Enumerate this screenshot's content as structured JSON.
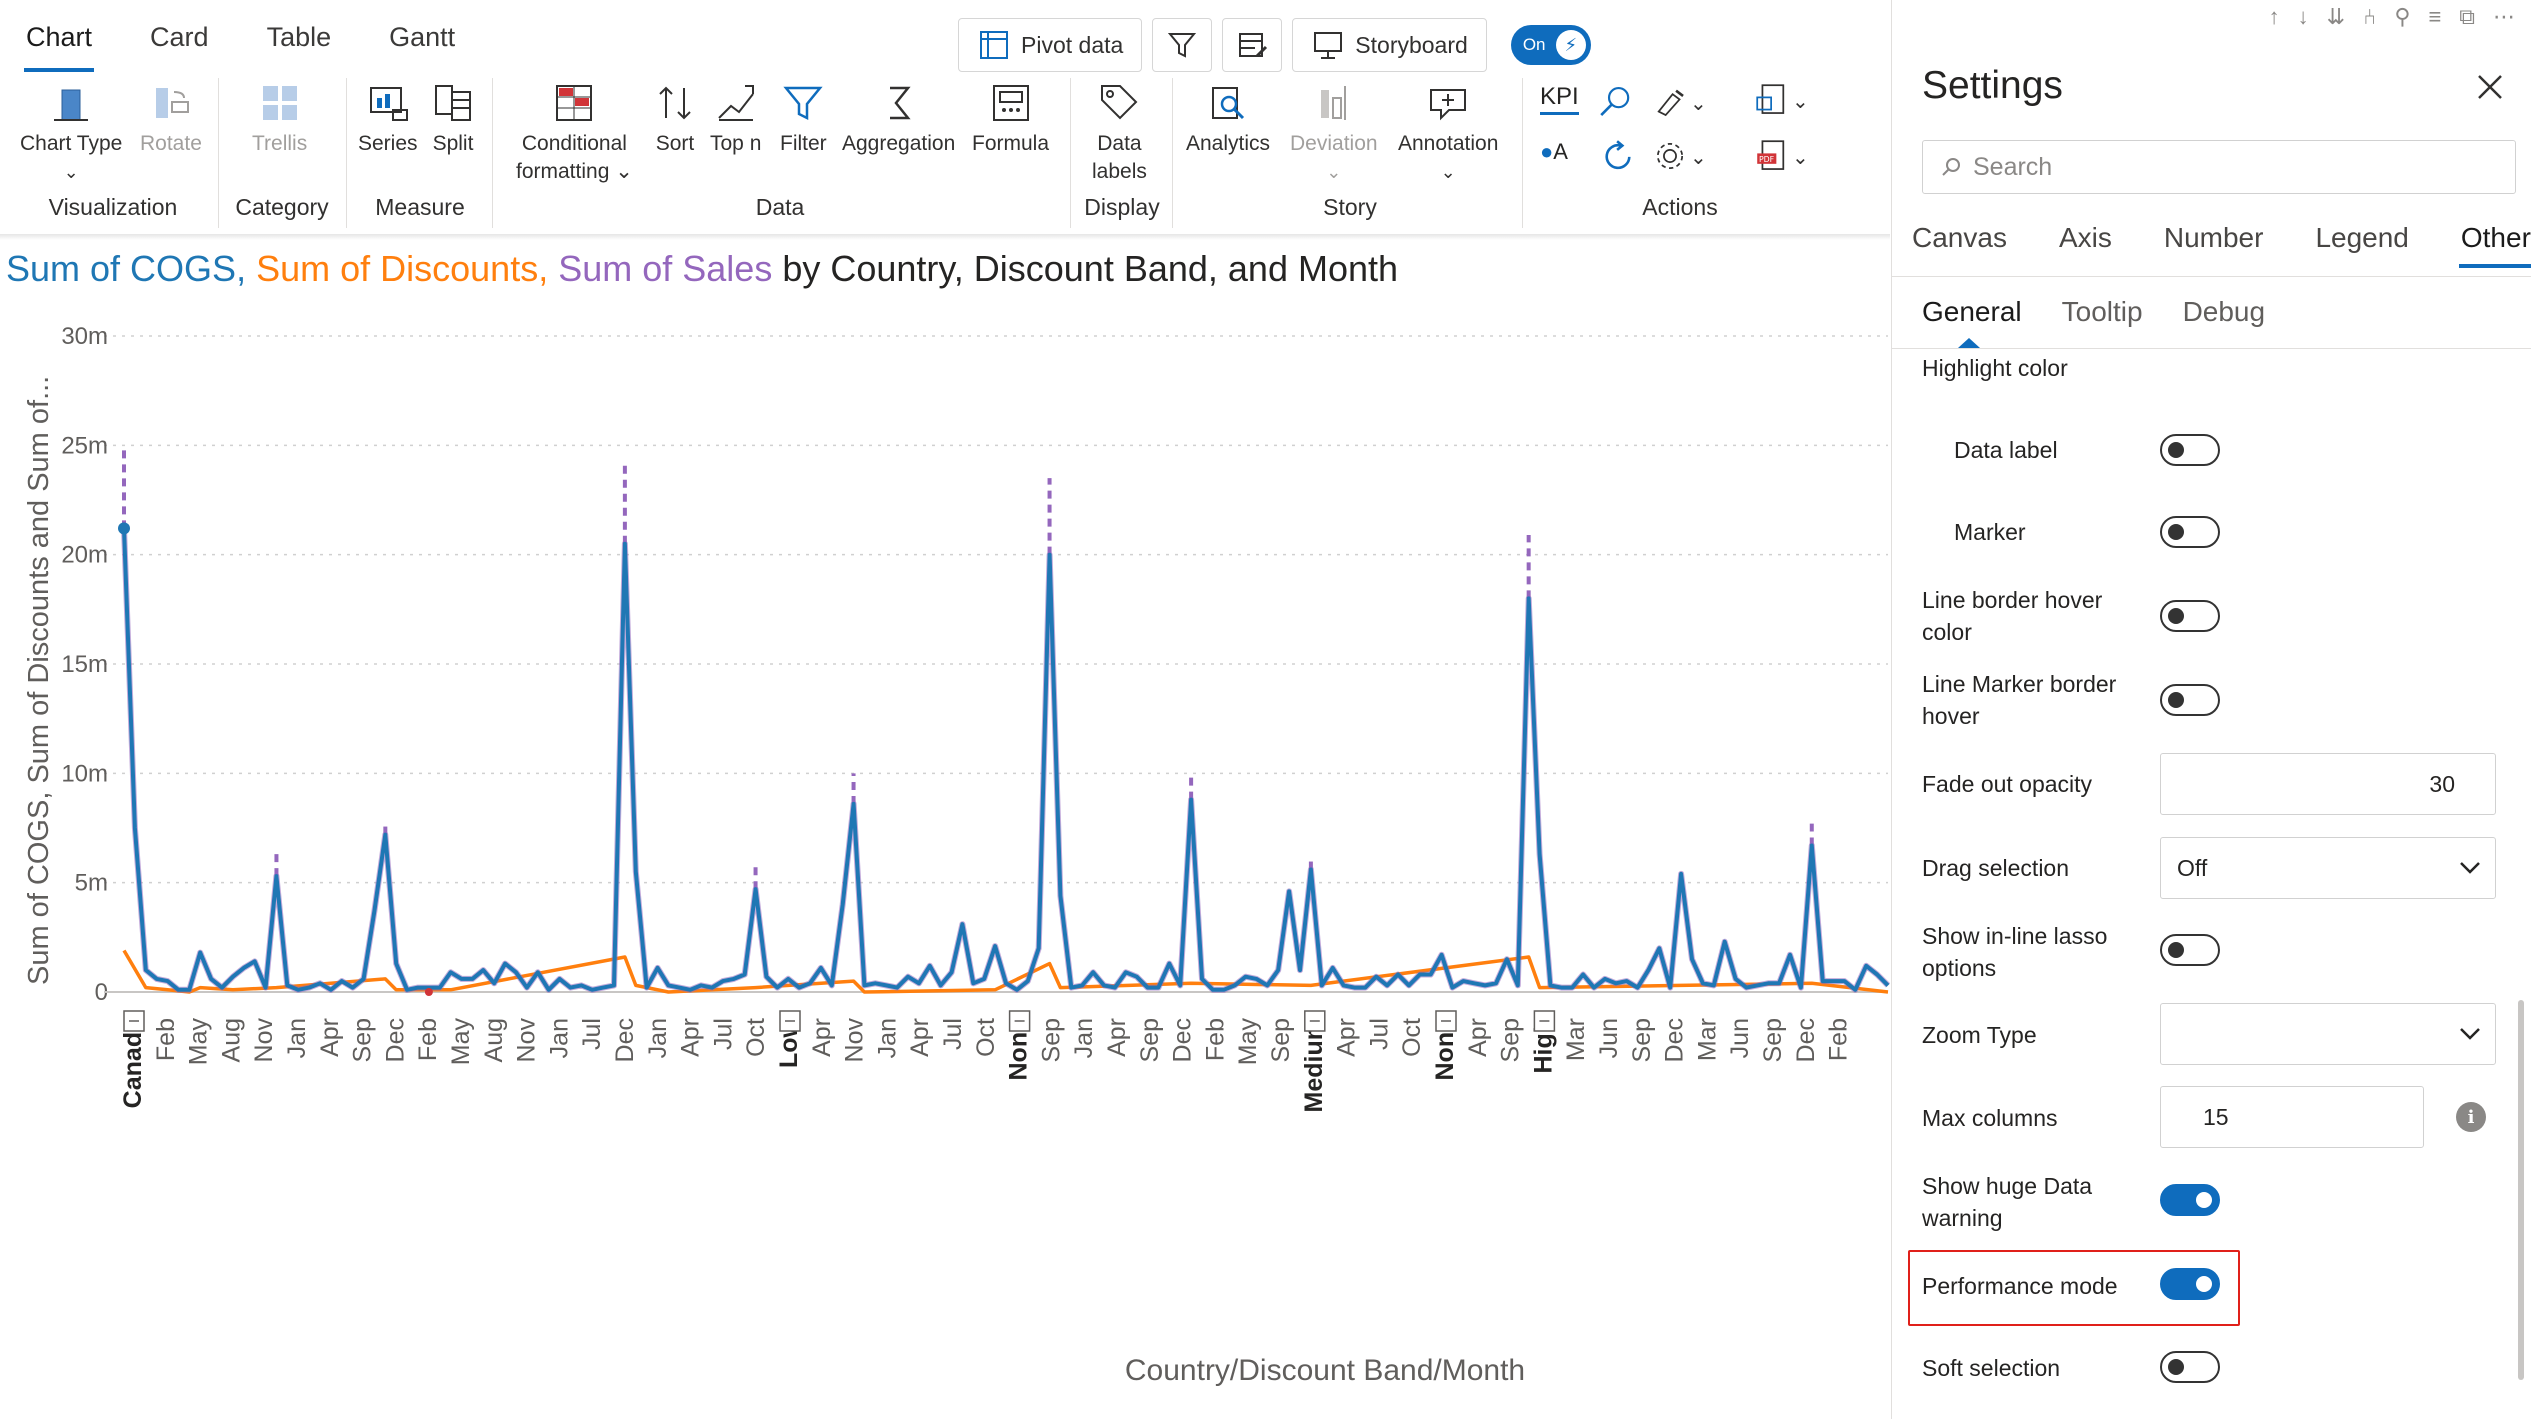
{
  "tabs": [
    "Chart",
    "Card",
    "Table",
    "Gantt"
  ],
  "top_buttons": {
    "pivot": "Pivot data",
    "storyboard": "Storyboard",
    "toggle": "On"
  },
  "ribbon": {
    "chart_type": "Chart Type",
    "rotate": "Rotate",
    "trellis": "Trellis",
    "series": "Series",
    "split": "Split",
    "cond_1": "Conditional",
    "cond_2": "formatting",
    "sort": "Sort",
    "topn": "Top n",
    "filter": "Filter",
    "aggregation": "Aggregation",
    "formula": "Formula",
    "data_labels_1": "Data",
    "data_labels_2": "labels",
    "analytics": "Analytics",
    "deviation": "Deviation",
    "annotation": "Annotation",
    "kpi": "KPI",
    "groups": {
      "visualization": "Visualization",
      "category": "Category",
      "measure": "Measure",
      "data": "Data",
      "display": "Display",
      "story": "Story",
      "actions": "Actions"
    }
  },
  "chart_title": {
    "cogs": "Sum of COGS",
    "discounts": "Sum of Discounts",
    "sales": "Sum of Sales",
    "rest": "by Country, Discount Band, and Month"
  },
  "chart_data": {
    "type": "line",
    "ylabel": "Sum of COGS, Sum of Discounts and Sum of...",
    "xlabel": "Country/Discount Band/Month",
    "ylim": [
      0,
      30000000
    ],
    "yticks": [
      "0",
      "5m",
      "10m",
      "15m",
      "20m",
      "25m",
      "30m"
    ],
    "x_labels": [
      "Canada",
      "Feb",
      "May",
      "Aug",
      "Nov",
      "Jan",
      "Apr",
      "Sep",
      "Dec",
      "Feb",
      "May",
      "Aug",
      "Nov",
      "Jan",
      "Jul",
      "Dec",
      "Jan",
      "Apr",
      "Jul",
      "Oct",
      "Low",
      "Apr",
      "Nov",
      "Jan",
      "Apr",
      "Jul",
      "Oct",
      "None",
      "Sep",
      "Jan",
      "Apr",
      "Sep",
      "Dec",
      "Feb",
      "May",
      "Sep",
      "Medium",
      "Apr",
      "Jul",
      "Oct",
      "None",
      "Apr",
      "Sep",
      "High",
      "Mar",
      "Jun",
      "Sep",
      "Dec",
      "Mar",
      "Jun",
      "Sep",
      "Dec",
      "Feb"
    ],
    "bold_labels": [
      "Canada",
      "Low",
      "None",
      "Medium",
      "High"
    ],
    "series": [
      {
        "name": "Sum of COGS",
        "color": "#1f77b4",
        "points": [
          [
            0,
            21.2
          ],
          [
            2,
            7.5
          ],
          [
            4,
            1
          ],
          [
            6,
            0.6
          ],
          [
            8,
            0.5
          ],
          [
            10,
            0.1
          ],
          [
            12,
            0.1
          ],
          [
            14,
            1.8
          ],
          [
            16,
            0.6
          ],
          [
            18,
            0.2
          ],
          [
            20,
            0.7
          ],
          [
            22,
            1.1
          ],
          [
            24,
            1.4
          ],
          [
            26,
            0.2
          ],
          [
            28,
            5.3
          ],
          [
            30,
            0.3
          ],
          [
            32,
            0.1
          ],
          [
            34,
            0.2
          ],
          [
            36,
            0.4
          ],
          [
            38,
            0.1
          ],
          [
            40,
            0.5
          ],
          [
            42,
            0.2
          ],
          [
            44,
            0.6
          ],
          [
            46,
            3.7
          ],
          [
            48,
            7.2
          ],
          [
            50,
            1.3
          ],
          [
            52,
            0.1
          ],
          [
            54,
            0.2
          ],
          [
            56,
            0.2
          ],
          [
            58,
            0.2
          ],
          [
            60,
            0.9
          ],
          [
            62,
            0.6
          ],
          [
            64,
            0.6
          ],
          [
            66,
            1.0
          ],
          [
            68,
            0.4
          ],
          [
            70,
            1.3
          ],
          [
            72,
            0.9
          ],
          [
            74,
            0.2
          ],
          [
            76,
            0.9
          ],
          [
            78,
            0.1
          ],
          [
            80,
            0.6
          ],
          [
            82,
            0.2
          ],
          [
            84,
            0.3
          ],
          [
            86,
            0.1
          ],
          [
            88,
            0.2
          ],
          [
            90,
            0.3
          ],
          [
            92,
            20.5
          ],
          [
            94,
            5.5
          ],
          [
            96,
            0.2
          ],
          [
            98,
            1.1
          ],
          [
            100,
            0.3
          ],
          [
            102,
            0.2
          ],
          [
            104,
            0.1
          ],
          [
            106,
            0.3
          ],
          [
            108,
            0.2
          ],
          [
            110,
            0.5
          ],
          [
            112,
            0.6
          ],
          [
            114,
            0.8
          ],
          [
            116,
            4.7
          ],
          [
            118,
            0.7
          ],
          [
            120,
            0.2
          ],
          [
            122,
            0.6
          ],
          [
            124,
            0.2
          ],
          [
            126,
            0.4
          ],
          [
            128,
            1.1
          ],
          [
            130,
            0.3
          ],
          [
            132,
            4.0
          ],
          [
            134,
            8.6
          ],
          [
            136,
            0.3
          ],
          [
            138,
            0.4
          ],
          [
            140,
            0.3
          ],
          [
            142,
            0.2
          ],
          [
            144,
            0.7
          ],
          [
            146,
            0.4
          ],
          [
            148,
            1.2
          ],
          [
            150,
            0.3
          ],
          [
            152,
            0.9
          ],
          [
            154,
            3.1
          ],
          [
            156,
            0.4
          ],
          [
            158,
            0.6
          ],
          [
            160,
            2.1
          ],
          [
            162,
            0.4
          ],
          [
            164,
            0.1
          ],
          [
            166,
            0.5
          ],
          [
            168,
            2.0
          ],
          [
            170,
            20.0
          ],
          [
            172,
            4.4
          ],
          [
            174,
            0.2
          ],
          [
            176,
            0.3
          ],
          [
            178,
            0.9
          ],
          [
            180,
            0.3
          ],
          [
            182,
            0.2
          ],
          [
            184,
            0.9
          ],
          [
            186,
            0.7
          ],
          [
            188,
            0.2
          ],
          [
            190,
            0.2
          ],
          [
            192,
            1.3
          ],
          [
            194,
            0.3
          ],
          [
            196,
            8.8
          ],
          [
            198,
            0.6
          ],
          [
            200,
            0.1
          ],
          [
            202,
            0.1
          ],
          [
            204,
            0.3
          ],
          [
            206,
            0.7
          ],
          [
            208,
            0.6
          ],
          [
            210,
            0.3
          ],
          [
            212,
            1.0
          ],
          [
            214,
            4.6
          ],
          [
            216,
            1.0
          ],
          [
            218,
            5.6
          ],
          [
            220,
            0.3
          ],
          [
            222,
            1.1
          ],
          [
            224,
            0.3
          ],
          [
            226,
            0.2
          ],
          [
            228,
            0.2
          ],
          [
            230,
            0.7
          ],
          [
            232,
            0.3
          ],
          [
            234,
            0.8
          ],
          [
            236,
            0.3
          ],
          [
            238,
            0.8
          ],
          [
            240,
            0.8
          ],
          [
            242,
            1.7
          ],
          [
            244,
            0.2
          ],
          [
            246,
            0.5
          ],
          [
            248,
            0.4
          ],
          [
            250,
            0.3
          ],
          [
            252,
            0.4
          ],
          [
            254,
            1.5
          ],
          [
            256,
            0.3
          ],
          [
            258,
            18.0
          ],
          [
            260,
            6.3
          ],
          [
            262,
            0.3
          ],
          [
            264,
            0.2
          ],
          [
            266,
            0.2
          ],
          [
            268,
            0.8
          ],
          [
            270,
            0.2
          ],
          [
            272,
            0.6
          ],
          [
            274,
            0.4
          ],
          [
            276,
            0.5
          ],
          [
            278,
            0.2
          ],
          [
            280,
            1.0
          ],
          [
            282,
            2.0
          ],
          [
            284,
            0.2
          ],
          [
            286,
            5.4
          ],
          [
            288,
            1.5
          ],
          [
            290,
            0.4
          ],
          [
            292,
            0.3
          ],
          [
            294,
            2.3
          ],
          [
            296,
            0.6
          ],
          [
            298,
            0.2
          ],
          [
            300,
            0.3
          ],
          [
            302,
            0.4
          ],
          [
            304,
            0.4
          ],
          [
            306,
            1.7
          ],
          [
            308,
            0.2
          ],
          [
            310,
            6.7
          ],
          [
            312,
            0.5
          ],
          [
            314,
            0.5
          ],
          [
            316,
            0.5
          ],
          [
            318,
            0.1
          ],
          [
            320,
            1.2
          ],
          [
            322,
            0.8
          ],
          [
            324,
            0.3
          ]
        ]
      },
      {
        "name": "Sum of Discounts",
        "color": "#ff7f0e",
        "points": [
          [
            0,
            1.9
          ],
          [
            4,
            0.2
          ],
          [
            8,
            0.1
          ],
          [
            12,
            0.0
          ],
          [
            14,
            0.2
          ],
          [
            20,
            0.1
          ],
          [
            28,
            0.2
          ],
          [
            48,
            0.6
          ],
          [
            50,
            0.1
          ],
          [
            60,
            0.1
          ],
          [
            92,
            1.6
          ],
          [
            94,
            0.3
          ],
          [
            100,
            0.0
          ],
          [
            116,
            0.2
          ],
          [
            134,
            0.5
          ],
          [
            136,
            0.0
          ],
          [
            160,
            0.1
          ],
          [
            170,
            1.3
          ],
          [
            172,
            0.2
          ],
          [
            196,
            0.4
          ],
          [
            218,
            0.3
          ],
          [
            258,
            1.6
          ],
          [
            260,
            0.2
          ],
          [
            286,
            0.3
          ],
          [
            310,
            0.4
          ],
          [
            324,
            0.0
          ]
        ]
      },
      {
        "name": "Sum of Sales",
        "color": "#9467bd",
        "peaks": [
          [
            0,
            24.8
          ],
          [
            28,
            6.5
          ],
          [
            48,
            7.7
          ],
          [
            92,
            24.2
          ],
          [
            116,
            5.8
          ],
          [
            134,
            10.0
          ],
          [
            170,
            23.5
          ],
          [
            196,
            10.0
          ],
          [
            218,
            6.0
          ],
          [
            258,
            20.9
          ],
          [
            310,
            7.7
          ]
        ]
      }
    ]
  },
  "settings": {
    "title": "Settings",
    "search_placeholder": "Search",
    "tabs": [
      "Canvas",
      "Axis",
      "Number",
      "Legend",
      "Others"
    ],
    "subtabs": [
      "General",
      "Tooltip",
      "Debug"
    ],
    "section": "Highlight color",
    "data_label": "Data label",
    "marker": "Marker",
    "line_border_1": "Line border hover",
    "line_border_2": "color",
    "line_marker_1": "Line Marker border",
    "line_marker_2": "hover",
    "fade_out": "Fade out opacity",
    "fade_value": "30",
    "drag_selection": "Drag selection",
    "drag_value": "Off",
    "lasso_1": "Show in-line lasso",
    "lasso_2": "options",
    "zoom_type": "Zoom Type",
    "zoom_value": "",
    "max_columns": "Max columns",
    "max_columns_value": "15",
    "huge_1": "Show huge Data",
    "huge_2": "warning",
    "performance": "Performance mode",
    "soft_selection": "Soft selection"
  }
}
